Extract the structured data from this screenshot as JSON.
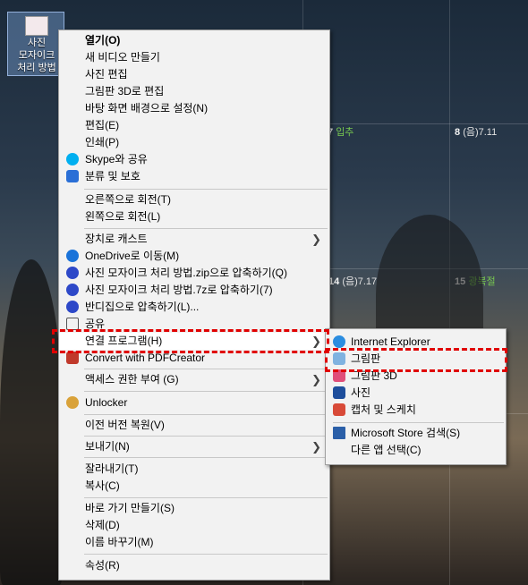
{
  "desktop_icon": {
    "label": "사진\n모자이크\n처리 방법"
  },
  "calendar": {
    "cells": [
      {
        "num": "7",
        "sub": "입추"
      },
      {
        "num": "8",
        "sub": "(음)7.11"
      },
      {
        "num": "14",
        "sub": "(음)7.17"
      },
      {
        "num": "15",
        "sub": "광복절"
      }
    ]
  },
  "context_menu": {
    "items": [
      {
        "label": "열기(O)"
      },
      {
        "label": "새 비디오 만들기"
      },
      {
        "label": "사진 편집"
      },
      {
        "label": "그림판 3D로 편집"
      },
      {
        "label": "바탕 화면 배경으로 설정(N)"
      },
      {
        "label": "편집(E)"
      },
      {
        "label": "인쇄(P)"
      },
      {
        "label": "Skype와 공유"
      },
      {
        "label": "분류 및 보호"
      },
      {
        "label": "오른쪽으로 회전(T)"
      },
      {
        "label": "왼쪽으로 회전(L)"
      },
      {
        "label": "장치로 캐스트"
      },
      {
        "label": "OneDrive로 이동(M)"
      },
      {
        "label": "사진 모자이크 처리 방법.zip으로 압축하기(Q)"
      },
      {
        "label": "사진 모자이크 처리 방법.7z로 압축하기(7)"
      },
      {
        "label": "반디집으로 압축하기(L)..."
      },
      {
        "label": "공유"
      },
      {
        "label": "연결 프로그램(H)"
      },
      {
        "label": "Convert with PDFCreator"
      },
      {
        "label": "액세스 권한 부여 (G)"
      },
      {
        "label": "Unlocker"
      },
      {
        "label": "이전 버전 복원(V)"
      },
      {
        "label": "보내기(N)"
      },
      {
        "label": "잘라내기(T)"
      },
      {
        "label": "복사(C)"
      },
      {
        "label": "바로 가기 만들기(S)"
      },
      {
        "label": "삭제(D)"
      },
      {
        "label": "이름 바꾸기(M)"
      },
      {
        "label": "속성(R)"
      }
    ]
  },
  "open_with_menu": {
    "items": [
      {
        "label": "Internet Explorer"
      },
      {
        "label": "그림판"
      },
      {
        "label": "그림판 3D"
      },
      {
        "label": "사진"
      },
      {
        "label": "캡처 및 스케치"
      },
      {
        "label": "Microsoft Store 검색(S)"
      },
      {
        "label": "다른 앱 선택(C)"
      }
    ]
  },
  "colors": {
    "highlight": "#e00000",
    "menu_bg": "#f2f2f2"
  }
}
